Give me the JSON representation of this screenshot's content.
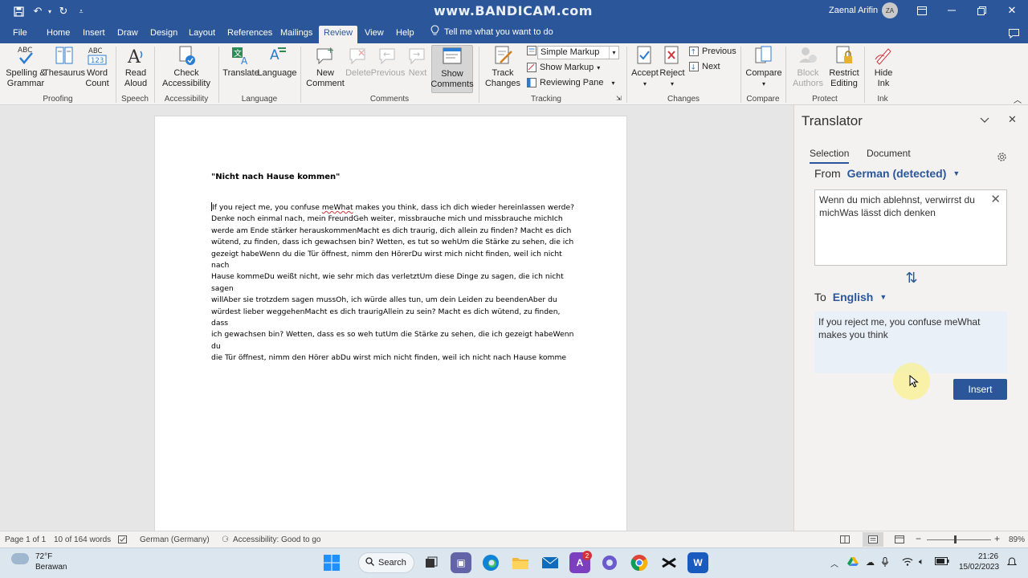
{
  "titlebar": {
    "watermark": "www.BANDICAM.com",
    "user_name": "Zaenal Arifin",
    "avatar_initials": "ZA",
    "accent": "#2b579a"
  },
  "tabs": [
    "File",
    "Home",
    "Insert",
    "Draw",
    "Design",
    "Layout",
    "References",
    "Mailings",
    "Review",
    "View",
    "Help"
  ],
  "active_tab": "Review",
  "tell_me": "Tell me what you want to do",
  "ribbon": {
    "spelling": [
      "Spelling &",
      "Grammar"
    ],
    "thesaurus": "Thesaurus",
    "word_count": [
      "Word",
      "Count"
    ],
    "read_aloud": [
      "Read",
      "Aloud"
    ],
    "check_accessibility": [
      "Check",
      "Accessibility"
    ],
    "translate": "Translate",
    "language": "Language",
    "new_comment": [
      "New",
      "Comment"
    ],
    "delete": "Delete",
    "previous_comment": "Previous",
    "next_comment": "Next",
    "show_comments": [
      "Show",
      "Comments"
    ],
    "track_changes": [
      "Track",
      "Changes"
    ],
    "markup_value": "Simple Markup",
    "show_markup": "Show Markup",
    "reviewing_pane": "Reviewing Pane",
    "accept": "Accept",
    "reject": "Reject",
    "previous_change": "Previous",
    "next_change": "Next",
    "compare": "Compare",
    "block_authors": [
      "Block",
      "Authors"
    ],
    "restrict_editing": [
      "Restrict",
      "Editing"
    ],
    "hide_ink": [
      "Hide",
      "Ink"
    ],
    "groups": {
      "proofing": "Proofing",
      "speech": "Speech",
      "accessibility": "Accessibility",
      "language": "Language",
      "comments": "Comments",
      "tracking": "Tracking",
      "changes": "Changes",
      "compare": "Compare",
      "protect": "Protect",
      "ink": "Ink"
    }
  },
  "document": {
    "title": "\"Nicht nach Hause kommen\"",
    "body_underlined": "meWhat",
    "lines": [
      "If you reject me, you confuse ",
      " makes you think, dass ich dich wieder hereinlassen werde?",
      "Denke noch einmal nach, mein FreundGeh weiter, missbrauche mich und missbrauche michIch",
      "werde am Ende stärker herauskommenMacht es dich traurig, dich allein zu finden? Macht es dich",
      "wütend, zu finden, dass ich gewachsen bin? Wetten, es tut so wehUm die Stärke zu sehen, die ich",
      "gezeigt habeWenn du die Tür öffnest, nimm den HörerDu wirst mich nicht finden, weil ich nicht nach",
      "Hause kommeDu weißt nicht, wie sehr mich das verletztUm diese Dinge zu sagen, die ich nicht sagen",
      "willAber sie trotzdem sagen mussOh, ich würde alles tun, um dein Leiden zu beendenAber du",
      "würdest lieber weggehenMacht es dich traurigAllein zu sein? Macht es dich wütend, zu finden, dass",
      "ich gewachsen bin? Wetten, dass es so weh tutUm die Stärke zu sehen, die ich gezeigt habeWenn du",
      "die Tür öffnest, nimm den Hörer abDu wirst mich nicht finden, weil ich nicht nach Hause komme"
    ]
  },
  "translator": {
    "title": "Translator",
    "tab_selection": "Selection",
    "tab_document": "Document",
    "from_label": "From",
    "from_lang": "German (detected)",
    "source_text": "Wenn du mich ablehnst, verwirrst du michWas lässt dich denken",
    "to_label": "To",
    "to_lang": "English",
    "output_text": "If you reject me, you confuse meWhat makes you think",
    "insert_label": "Insert"
  },
  "statusbar": {
    "page": "Page 1 of 1",
    "words": "10 of 164 words",
    "language": "German (Germany)",
    "accessibility": "Accessibility: Good to go",
    "zoom": "89%",
    "zoom_fraction": 0.44
  },
  "taskbar": {
    "temperature": "72°F",
    "weather": "Berawan",
    "search": "Search",
    "notification_count": "2",
    "time": "21:26",
    "date": "15/02/2023"
  }
}
